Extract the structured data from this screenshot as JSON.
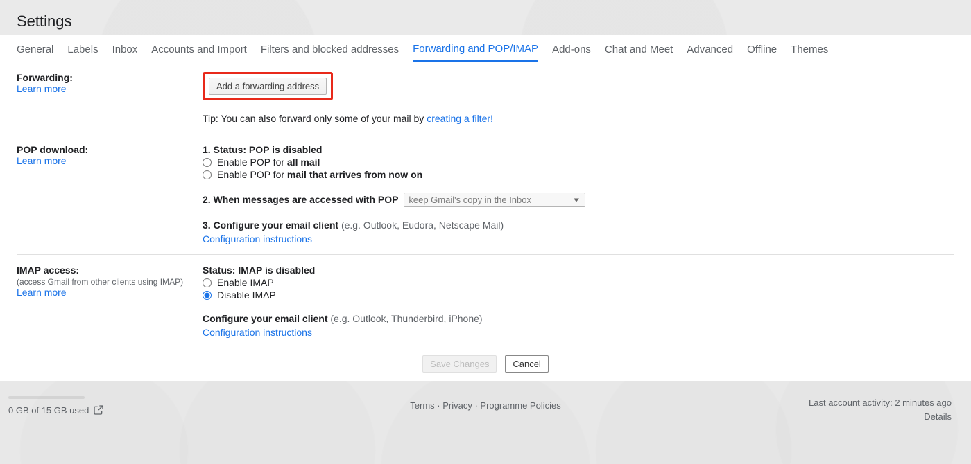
{
  "header": {
    "title": "Settings"
  },
  "tabs": [
    {
      "label": "General"
    },
    {
      "label": "Labels"
    },
    {
      "label": "Inbox"
    },
    {
      "label": "Accounts and Import"
    },
    {
      "label": "Filters and blocked addresses"
    },
    {
      "label": "Forwarding and POP/IMAP",
      "active": true
    },
    {
      "label": "Add-ons"
    },
    {
      "label": "Chat and Meet"
    },
    {
      "label": "Advanced"
    },
    {
      "label": "Offline"
    },
    {
      "label": "Themes"
    }
  ],
  "forwarding": {
    "label": "Forwarding:",
    "learn_more": "Learn more",
    "add_button": "Add a forwarding address",
    "tip_prefix": "Tip: You can also forward only some of your mail by ",
    "tip_link": "creating a filter!"
  },
  "pop": {
    "label": "POP download:",
    "learn_more": "Learn more",
    "status_prefix": "1. Status: ",
    "status_value": "POP is disabled",
    "opt1_prefix": "Enable POP for ",
    "opt1_bold": "all mail",
    "opt2_prefix": "Enable POP for ",
    "opt2_bold": "mail that arrives from now on",
    "step2_label": "2. When messages are accessed with POP",
    "select_value": "keep Gmail's copy in the Inbox",
    "step3_label": "3. Configure your email client ",
    "step3_paren": "(e.g. Outlook, Eudora, Netscape Mail)",
    "config_link": "Configuration instructions"
  },
  "imap": {
    "label": "IMAP access:",
    "subtitle": "(access Gmail from other clients using IMAP)",
    "learn_more": "Learn more",
    "status_prefix": "Status: ",
    "status_value": "IMAP is disabled",
    "opt_enable": "Enable IMAP",
    "opt_disable": "Disable IMAP",
    "configure_label": "Configure your email client ",
    "configure_paren": "(e.g. Outlook, Thunderbird, iPhone)",
    "config_link": "Configuration instructions"
  },
  "actions": {
    "save": "Save Changes",
    "cancel": "Cancel"
  },
  "footer": {
    "storage": "0 GB of 15 GB used",
    "terms": "Terms",
    "privacy": "Privacy",
    "policies": "Programme Policies",
    "activity": "Last account activity: 2 minutes ago",
    "details": "Details"
  }
}
